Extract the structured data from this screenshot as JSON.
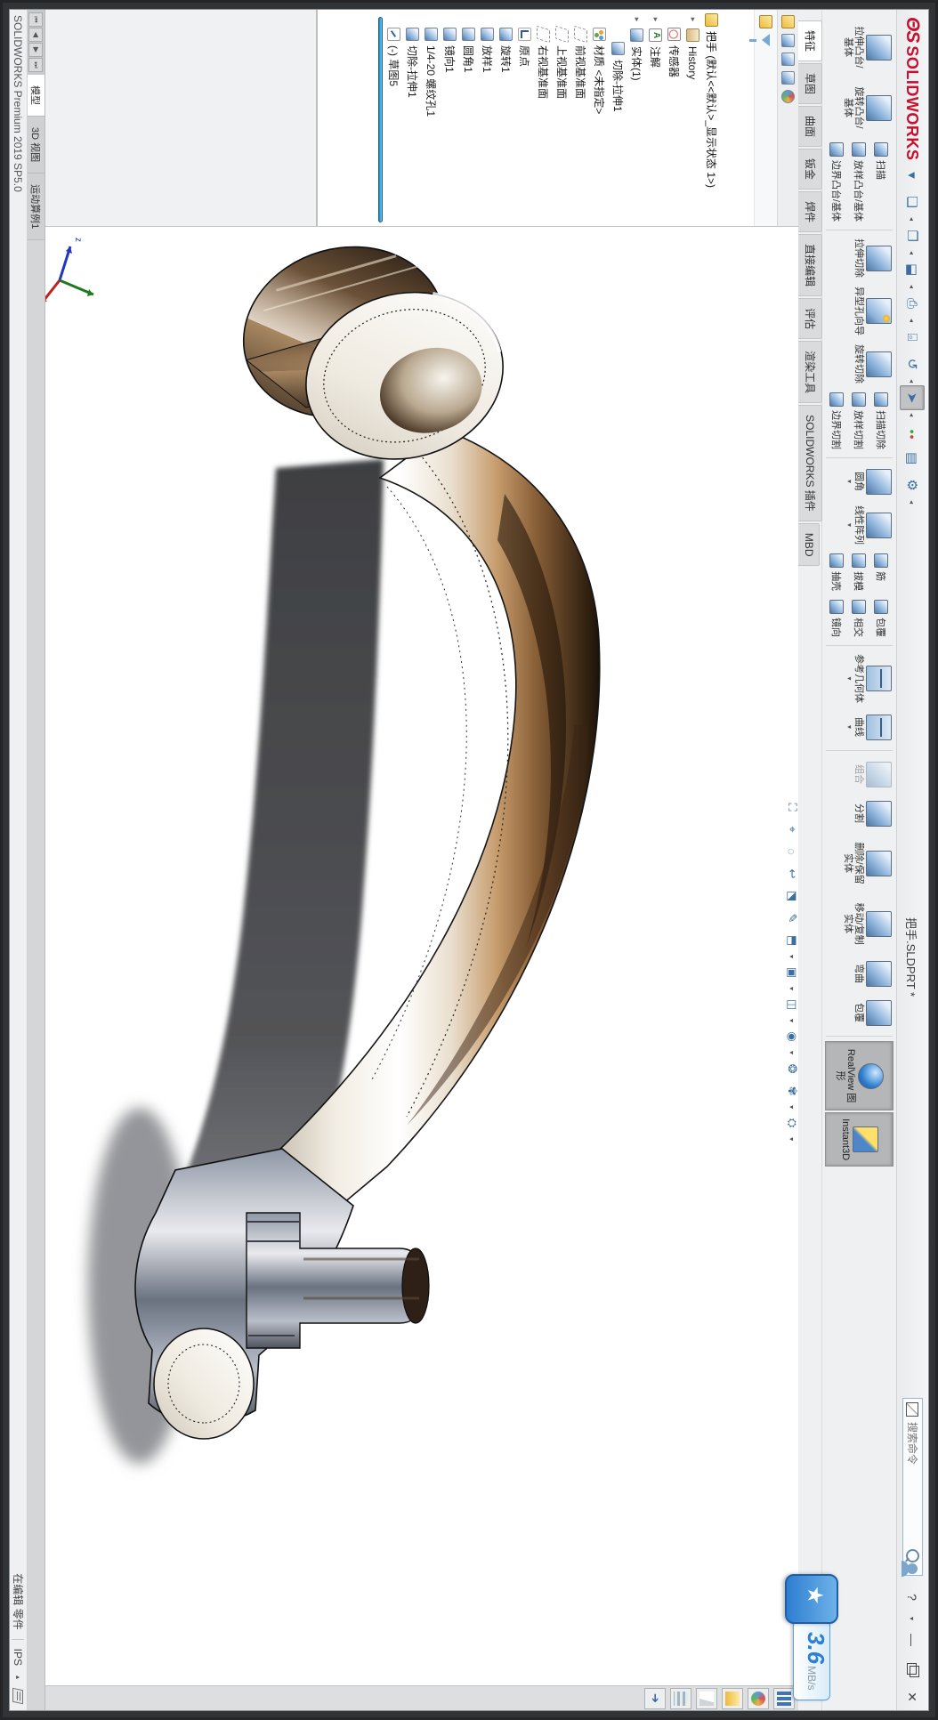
{
  "window": {
    "brand": "SOLIDWORKS",
    "brand_color": "#c8102e",
    "doc_title": "把手.SLDPRT *",
    "search_placeholder": "搜索命令",
    "minimize": "—",
    "close": "✕",
    "help": "?"
  },
  "qat": {
    "items": [
      {
        "name": "menu-expand",
        "glyph": "▾"
      },
      {
        "name": "new",
        "glyph": "❏",
        "caret": true
      },
      {
        "name": "open",
        "glyph": "❐",
        "caret": true
      },
      {
        "name": "save",
        "glyph": "⬓",
        "caret": true
      },
      {
        "name": "print",
        "glyph": "⎙",
        "caret": true
      },
      {
        "name": "print-preview",
        "glyph": "⌻"
      },
      {
        "name": "undo",
        "glyph": "↺",
        "caret": true
      },
      {
        "name": "select",
        "glyph": "➤",
        "pressed": true,
        "caret": true
      },
      {
        "name": "rebuild",
        "glyph": "●",
        "caret": false
      },
      {
        "name": "file-properties",
        "glyph": "▤"
      },
      {
        "name": "options",
        "glyph": "⚙",
        "caret": true
      }
    ]
  },
  "ribbon": {
    "tabs": [
      {
        "label": "特征",
        "active": true
      },
      {
        "label": "草图"
      },
      {
        "label": "曲面"
      },
      {
        "label": "钣金"
      },
      {
        "label": "焊件"
      },
      {
        "label": "直接编辑"
      },
      {
        "label": "评估"
      },
      {
        "label": "渲染工具"
      },
      {
        "label": "SOLIDWORKS 插件"
      },
      {
        "label": "MBD"
      }
    ],
    "items": [
      {
        "t": "big",
        "label": "拉伸凸台/基体",
        "name": "extruded-boss-base"
      },
      {
        "t": "big",
        "label": "旋转凸台/基体",
        "name": "revolved-boss-base"
      },
      {
        "t": "stack",
        "rows": [
          {
            "label": "扫描",
            "name": "swept-boss-base"
          },
          {
            "label": "放样凸台/基体",
            "name": "lofted-boss-base"
          },
          {
            "label": "边界凸台/基体",
            "name": "boundary-boss-base"
          }
        ]
      },
      {
        "t": "sep"
      },
      {
        "t": "big",
        "label": "拉伸切除",
        "name": "extruded-cut"
      },
      {
        "t": "big",
        "label": "异型孔向导",
        "name": "hole-wizard",
        "icon": "hole"
      },
      {
        "t": "big",
        "label": "旋转切除",
        "name": "revolved-cut"
      },
      {
        "t": "stack",
        "rows": [
          {
            "label": "扫描切除",
            "name": "swept-cut"
          },
          {
            "label": "放样切割",
            "name": "lofted-cut"
          },
          {
            "label": "边界切割",
            "name": "boundary-cut"
          }
        ]
      },
      {
        "t": "sep"
      },
      {
        "t": "big",
        "label": "圆角",
        "name": "fillet",
        "caret": true
      },
      {
        "t": "big",
        "label": "线性阵列",
        "name": "linear-pattern",
        "caret": true
      },
      {
        "t": "stack",
        "rows": [
          {
            "label": "筋",
            "name": "rib"
          },
          {
            "label": "拔模",
            "name": "draft"
          },
          {
            "label": "抽壳",
            "name": "shell"
          }
        ]
      },
      {
        "t": "stack",
        "rows": [
          {
            "label": "包覆",
            "name": "wrap"
          },
          {
            "label": "相交",
            "name": "intersect"
          },
          {
            "label": "镜向",
            "name": "mirror"
          }
        ]
      },
      {
        "t": "sep"
      },
      {
        "t": "big",
        "label": "参考几何体",
        "name": "reference-geometry",
        "icon": "ref",
        "caret": true
      },
      {
        "t": "big",
        "label": "曲线",
        "name": "curves",
        "icon": "ref",
        "caret": true
      },
      {
        "t": "sep"
      },
      {
        "t": "big",
        "label": "组合",
        "name": "combine",
        "disabled": true
      },
      {
        "t": "big",
        "label": "分割",
        "name": "split"
      },
      {
        "t": "big",
        "label": "删除/保留实体",
        "name": "delete-keep-body"
      },
      {
        "t": "big",
        "label": "移动/复制实体",
        "name": "move-copy-body"
      },
      {
        "t": "big",
        "label": "弯曲",
        "name": "flex"
      },
      {
        "t": "big",
        "label": "包覆",
        "name": "wrap-2"
      },
      {
        "t": "sep"
      },
      {
        "t": "toggle",
        "label": "RealView 图形",
        "name": "realview-graphics",
        "icon": "realview"
      },
      {
        "t": "toggle",
        "label": "Instant3D",
        "name": "instant3d",
        "icon": "instant3d"
      }
    ]
  },
  "panel": {
    "tabs": [
      {
        "name": "featuremanager-tree",
        "cls": "ti-part"
      },
      {
        "name": "propertymanager",
        "cls": ""
      },
      {
        "name": "configurationmanager",
        "cls": ""
      },
      {
        "name": "dimxpertmanager",
        "cls": ""
      },
      {
        "name": "displaymanager",
        "cls": "tp-lib"
      }
    ],
    "header": "把手 (默认<<默认>_显示状态 1>)",
    "tree": [
      {
        "label": "History",
        "icon": "ti-history",
        "expand": true
      },
      {
        "label": "传感器",
        "icon": "ti-sensors"
      },
      {
        "label": "注解",
        "icon": "ti-ann",
        "expand": true
      },
      {
        "label": "实体(1)",
        "icon": "ti",
        "expand": true
      },
      {
        "label": "切除-拉伸1",
        "icon": "ti",
        "child": true
      },
      {
        "label": "材质 <未指定>",
        "icon": "ti-mat"
      },
      {
        "label": "前视基准面",
        "icon": "ti-plane"
      },
      {
        "label": "上视基准面",
        "icon": "ti-plane"
      },
      {
        "label": "右视基准面",
        "icon": "ti-plane"
      },
      {
        "label": "原点",
        "icon": "ti-origin"
      },
      {
        "label": "旋转1",
        "icon": "ti"
      },
      {
        "label": "放样1",
        "icon": "ti"
      },
      {
        "label": "圆角1",
        "icon": "ti"
      },
      {
        "label": "镜向1",
        "icon": "ti"
      },
      {
        "label": "1/4-20 螺纹孔1",
        "icon": "ti"
      },
      {
        "label": "切除-拉伸1",
        "icon": "ti"
      },
      {
        "label": "(-) 草图5",
        "icon": "ti-sketch"
      }
    ],
    "rollback_color": "#1d7fc4"
  },
  "headsup": {
    "items": [
      {
        "name": "zoom-fit",
        "glyph": "⛶"
      },
      {
        "name": "zoom-to-area",
        "glyph": "⌖"
      },
      {
        "name": "zoom-magnify",
        "glyph": "◌"
      },
      {
        "name": "previous-view",
        "glyph": "↩"
      },
      {
        "name": "section-view",
        "glyph": "⬔"
      },
      {
        "name": "3d-drawing-view",
        "glyph": "✎"
      },
      {
        "name": "view-orientation",
        "glyph": "⬒",
        "caret": true
      },
      {
        "name": "display-style",
        "glyph": "▣",
        "caret": true
      },
      {
        "name": "hide-show-items",
        "glyph": "◫",
        "caret": true
      },
      {
        "name": "visibility",
        "glyph": "◉",
        "caret": true
      },
      {
        "name": "edit-appearance",
        "glyph": "❂"
      },
      {
        "name": "apply-scene",
        "glyph": "✾",
        "caret": true
      },
      {
        "name": "view-settings",
        "glyph": "⛭",
        "caret": true
      }
    ]
  },
  "taskpane": {
    "items": [
      {
        "name": "solidworks-resources",
        "cls": "tp-res"
      },
      {
        "name": "design-library",
        "cls": "tp-lib"
      },
      {
        "name": "file-explorer",
        "cls": "tp-exp"
      },
      {
        "name": "view-palette",
        "cls": "tp-pal"
      },
      {
        "name": "appearances-scenes",
        "cls": "tp-app"
      },
      {
        "name": "custom-properties",
        "cls": "tp-cp",
        "glyph": "➔"
      }
    ]
  },
  "viewtabs": {
    "items": [
      {
        "label": "模型",
        "active": true
      },
      {
        "label": "3D 视图"
      },
      {
        "label": "运动算例1"
      }
    ]
  },
  "statusbar": {
    "left": "SOLIDWORKS Premium 2019 SP5.0",
    "editing": "在编辑 零件",
    "units": "IPS"
  },
  "overlay": {
    "speed": "3.6",
    "unit": "MB/s",
    "color": "#2e7fd1"
  }
}
